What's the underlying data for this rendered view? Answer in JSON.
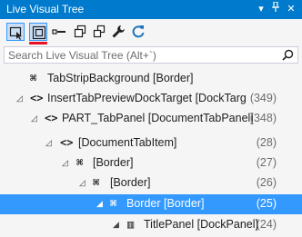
{
  "window": {
    "title": "Live Visual Tree",
    "dropdown_glyph": "▾",
    "pin_glyph": "⊥",
    "close_glyph": "✕"
  },
  "toolbar": {
    "tools": [
      {
        "name": "select-element-icon",
        "active": true
      },
      {
        "name": "display-layout-adorners-icon",
        "active": true
      },
      {
        "name": "track-focused-element-icon",
        "active": false
      },
      {
        "name": "show-just-my-xaml-icon",
        "active": false
      },
      {
        "name": "expand-all-icon",
        "active": false
      },
      {
        "name": "properties-wrench-icon",
        "active": false
      },
      {
        "name": "refresh-icon",
        "active": false
      }
    ]
  },
  "search": {
    "placeholder": "Search Live Visual Tree (Alt+`)"
  },
  "tree": {
    "rows": [
      {
        "expander": "",
        "icon": "⌘",
        "label": "TabStripBackground [Border]",
        "count": ""
      },
      {
        "expander": "◿",
        "icon": "<>",
        "label": "InsertTabPreviewDockTarget [DockTarget",
        "count": "(349)"
      },
      {
        "expander": "◿",
        "icon": "<>",
        "label": "PART_TabPanel [DocumentTabPanel]",
        "count": "(348)"
      },
      {
        "expander": "◿",
        "icon": "<>",
        "label": "[DocumentTabItem]",
        "count": "(28)"
      },
      {
        "expander": "◿",
        "icon": "⌘",
        "label": "[Border]",
        "count": "(27)"
      },
      {
        "expander": "◿",
        "icon": "⌘",
        "label": "[Border]",
        "count": "(26)"
      },
      {
        "expander": "◢",
        "icon": "⌘",
        "label": "Border [Border]",
        "count": "(25)",
        "selected": true
      },
      {
        "expander": "◢",
        "icon": "▥",
        "label": "TitlePanel [DockPanel]",
        "count": "(24)"
      }
    ]
  },
  "colors": {
    "accent": "#007acc",
    "selection": "#3399ff",
    "highlight_underline": "#e81123"
  }
}
